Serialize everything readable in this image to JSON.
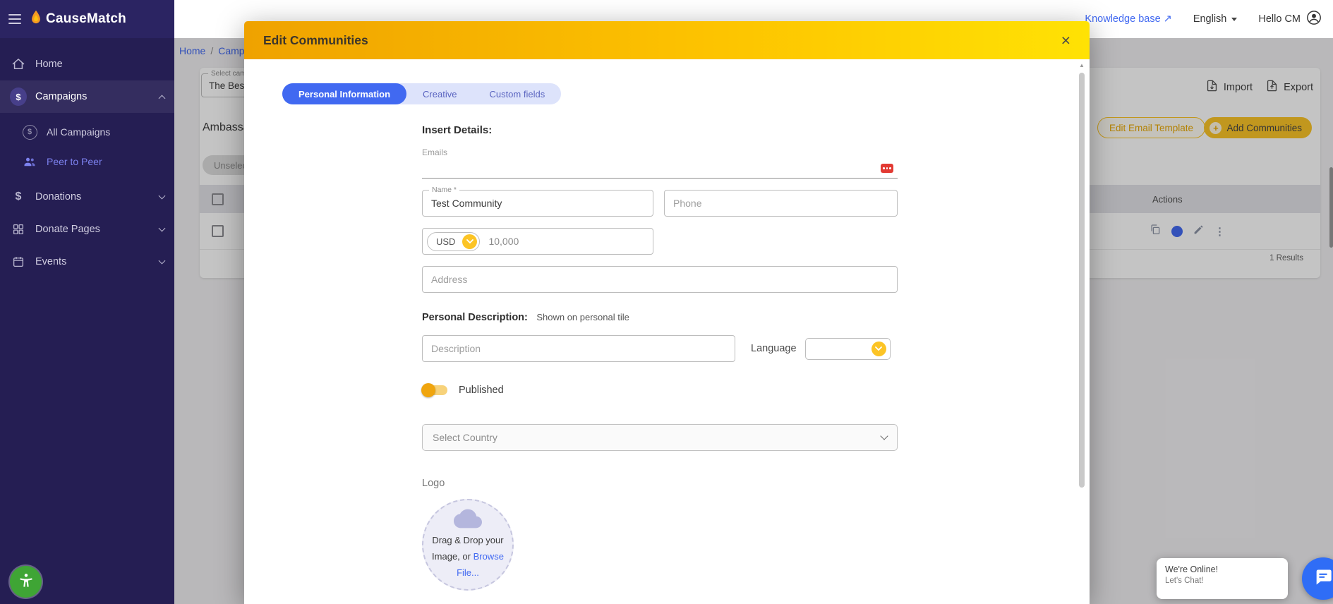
{
  "theme": {
    "sidebar_bg": "#251e53",
    "accent_blue": "#4169f1",
    "accent_yellow": "#fcc425",
    "active_nav_color": "#7d82f0",
    "modal_header_gradient_start": "#efa200",
    "modal_header_gradient_end": "#ffe204",
    "chat_button_color": "#2f6df6",
    "emails_icon_color": "#e23a33"
  },
  "icons": {
    "dollar": "$",
    "plus": "+",
    "close": "×",
    "external": "↗",
    "kebab": "⋮",
    "scroll_up": "▲"
  },
  "sidebar": {
    "brand": "CauseMatch",
    "items": [
      {
        "label": "Home"
      },
      {
        "label": "Campaigns"
      },
      {
        "label": "All Campaigns"
      },
      {
        "label": "Peer to Peer"
      },
      {
        "label": "Donations"
      },
      {
        "label": "Donate Pages"
      },
      {
        "label": "Events"
      }
    ]
  },
  "topbar": {
    "knowledge_base": "Knowledge base",
    "language": "English",
    "greeting": "Hello CM"
  },
  "page": {
    "breadcrumb_home": "Home",
    "breadcrumb_sep": "/",
    "breadcrumb_current": "Campaigns",
    "campaign_select_label": "Select campaign",
    "campaign_select_value": "The Best C",
    "import_button": "Import",
    "export_button": "Export",
    "section_title": "Ambassadors",
    "edit_email_template_button": "Edit Email Template",
    "add_communities_button": "Add Communities",
    "unselect_button": "Unselect All",
    "actions_header": "Actions",
    "results_text": "1 Results"
  },
  "modal": {
    "title": "Edit Communities",
    "tabs": [
      {
        "label": "Personal Information",
        "active": true
      },
      {
        "label": "Creative",
        "active": false
      },
      {
        "label": "Custom fields",
        "active": false
      }
    ],
    "insert_details_label": "Insert Details:",
    "emails_label": "Emails",
    "name_label": "Name *",
    "name_value": "Test Community",
    "phone_placeholder": "Phone",
    "currency_value": "USD",
    "amount_value": "10,000",
    "address_placeholder": "Address",
    "description_section_label": "Personal Description:",
    "description_section_hint": "Shown on personal tile",
    "description_placeholder": "Description",
    "language_label": "Language",
    "published_label": "Published",
    "published_state": "on",
    "country_placeholder": "Select Country",
    "logo_label": "Logo",
    "dropzone_text": "Drag & Drop your Image, or ",
    "dropzone_link": "Browse File..."
  },
  "chat": {
    "line1": "We're Online!",
    "line2": "Let's Chat!"
  }
}
